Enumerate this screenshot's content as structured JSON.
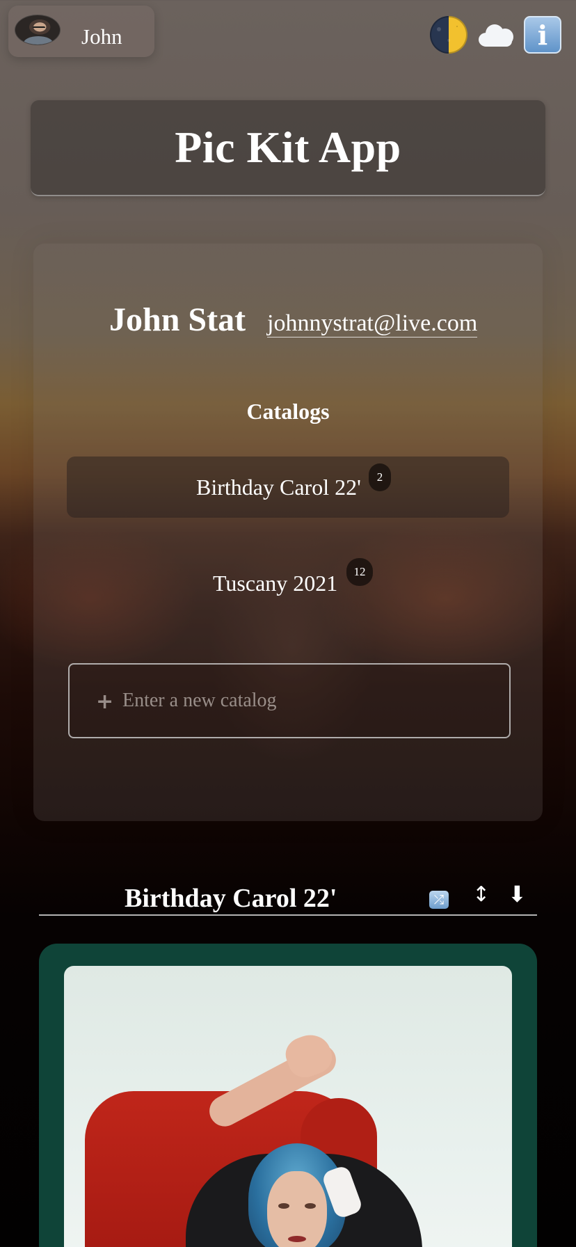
{
  "header": {
    "user": {
      "name": "John"
    },
    "icons": [
      "half-moon-icon",
      "cloud-icon",
      "info-icon"
    ]
  },
  "app": {
    "title": "Pic Kit App"
  },
  "profile": {
    "name": "John Stat",
    "email": "johnnystrat@live.com"
  },
  "catalogs": {
    "heading": "Catalogs",
    "items": [
      {
        "label": "Birthday Carol 22'",
        "count": "2",
        "active": true
      },
      {
        "label": "Tuscany 2021",
        "count": "12",
        "active": false
      }
    ],
    "new_placeholder": "Enter a new catalog"
  },
  "current_catalog": {
    "title": "Birthday Carol 22'",
    "actions": [
      "shuffle-icon",
      "sort-icon",
      "download-icon"
    ]
  },
  "colors": {
    "card_green": "#0f4438",
    "info_blue": "#5f93c9",
    "moon_yellow": "#f2c12e"
  }
}
